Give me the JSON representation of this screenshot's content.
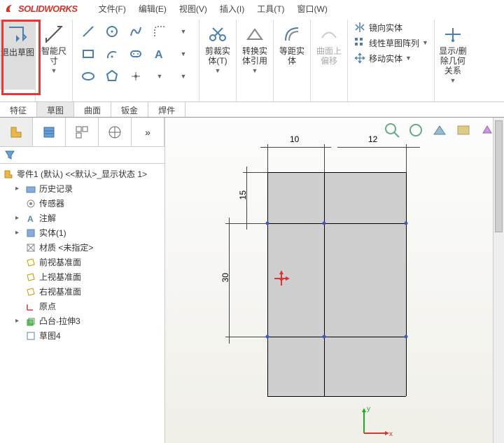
{
  "app": {
    "name": "SOLIDWORKS"
  },
  "menu": [
    "文件(F)",
    "编辑(E)",
    "视图(V)",
    "插入(I)",
    "工具(T)",
    "窗口(W)"
  ],
  "ribbon": {
    "exit_sketch": "退出草图",
    "smart_dim": "智能尺寸",
    "trim": "剪裁实体(T)",
    "convert": "转换实体引用",
    "offset": "等距实体",
    "surface_offset": "曲面上偏移",
    "mirror": "镜向实体",
    "linear_pattern": "线性草图阵列",
    "move": "移动实体",
    "show_rel": "显示/删除几何关系"
  },
  "tabs": [
    "特征",
    "草图",
    "曲面",
    "钣金",
    "焊件"
  ],
  "active_tab": "草图",
  "tree": {
    "root": "零件1 (默认) <<默认>_显示状态 1>",
    "nodes": {
      "history": "历史记录",
      "sensors": "传感器",
      "annotations": "注解",
      "solids": "实体(1)",
      "material": "材质 <未指定>",
      "front": "前视基准面",
      "top": "上视基准面",
      "right": "右视基准面",
      "origin": "原点",
      "extrude": "凸台-拉伸3",
      "sketch": "草图4"
    }
  },
  "dims": {
    "w1": "10",
    "w2": "12",
    "h1": "15",
    "h2": "30"
  },
  "triad": {
    "x": "x",
    "y": "y"
  }
}
